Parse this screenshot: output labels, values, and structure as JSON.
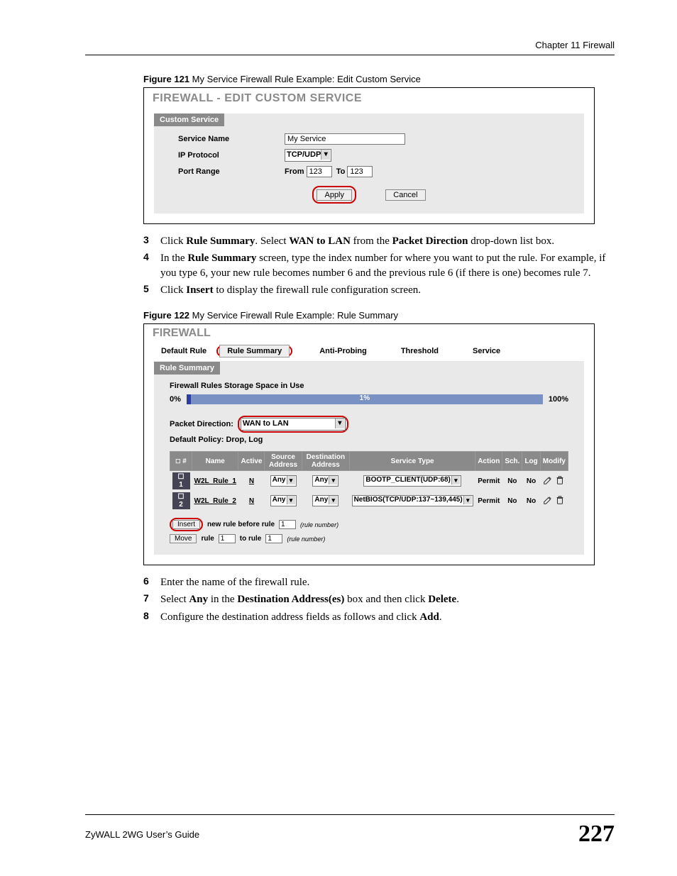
{
  "header": {
    "chapter": "Chapter 11 Firewall"
  },
  "fig121": {
    "caption_prefix": "Figure 121",
    "caption_rest": "   My Service Firewall Rule Example: Edit Custom Service",
    "window_title": "FIREWALL - EDIT CUSTOM SERVICE",
    "panel_title": "Custom Service",
    "labels": {
      "service_name": "Service Name",
      "ip_protocol": "IP Protocol",
      "port_range": "Port Range",
      "from": "From",
      "to": "To"
    },
    "values": {
      "service_name": "My Service",
      "ip_protocol": "TCP/UDP",
      "port_from": "123",
      "port_to": "123"
    },
    "buttons": {
      "apply": "Apply",
      "cancel": "Cancel"
    }
  },
  "instr_a": {
    "3": {
      "num": "3",
      "pre": "Click ",
      "b1": "Rule Summary",
      "mid1": ". Select ",
      "b2": "WAN to LAN",
      "mid2": " from the ",
      "b3": "Packet Direction",
      "post": " drop-down list box."
    },
    "4": {
      "num": "4",
      "pre": "In the ",
      "b1": "Rule Summary",
      "post": " screen, type the index number for where you want to put the rule. For example, if you type 6, your new rule becomes number 6 and the previous rule 6 (if there is one) becomes rule 7."
    },
    "5": {
      "num": "5",
      "pre": "Click ",
      "b1": "Insert",
      "post": " to display the firewall rule configuration screen."
    }
  },
  "fig122": {
    "caption_prefix": "Figure 122",
    "caption_rest": "   My Service Firewall Rule Example: Rule Summary",
    "window_title": "FIREWALL",
    "tabs": {
      "default_rule": "Default Rule",
      "rule_summary": "Rule Summary",
      "anti_probing": "Anti-Probing",
      "threshold": "Threshold",
      "service": "Service"
    },
    "panel_title": "Rule Summary",
    "storage_label": "Firewall Rules Storage Space in Use",
    "percent_left": "0%",
    "percent_mid": "1%",
    "percent_right": "100%",
    "packet_direction_label": "Packet Direction:",
    "packet_direction_value": "WAN to LAN",
    "default_policy": "Default Policy: Drop, Log",
    "columns": {
      "num": "#",
      "name": "Name",
      "active": "Active",
      "src": "Source Address",
      "dst": "Destination Address",
      "svc": "Service Type",
      "action": "Action",
      "sch": "Sch.",
      "log": "Log",
      "modify": "Modify"
    },
    "rows": [
      {
        "idx": "1",
        "name": "W2L_Rule_1",
        "active": "N",
        "src": "Any",
        "dst": "Any",
        "svc": "BOOTP_CLIENT(UDP:68)",
        "action": "Permit",
        "sch": "No",
        "log": "No"
      },
      {
        "idx": "2",
        "name": "W2L_Rule_2",
        "active": "N",
        "src": "Any",
        "dst": "Any",
        "svc": "NetBIOS(TCP/UDP:137~139,445)",
        "action": "Permit",
        "sch": "No",
        "log": "No"
      }
    ],
    "action_bar": {
      "insert": "Insert",
      "insert_text1": "new rule before rule",
      "insert_val": "1",
      "note": "(rule number)",
      "move": "Move",
      "move_text1": "rule",
      "move_val1": "1",
      "move_text2": "to rule",
      "move_val2": "1"
    }
  },
  "instr_b": {
    "6": {
      "num": "6",
      "text": "Enter the name of the firewall rule."
    },
    "7": {
      "num": "7",
      "pre": "Select ",
      "b1": "Any",
      "mid1": " in the ",
      "b2": "Destination Address(es)",
      "mid2": " box and then click ",
      "b3": "Delete",
      "post": "."
    },
    "8": {
      "num": "8",
      "pre": "Configure the destination address fields as follows and click ",
      "b1": "Add",
      "post": "."
    }
  },
  "footer": {
    "guide": "ZyWALL 2WG User’s Guide",
    "page": "227"
  }
}
